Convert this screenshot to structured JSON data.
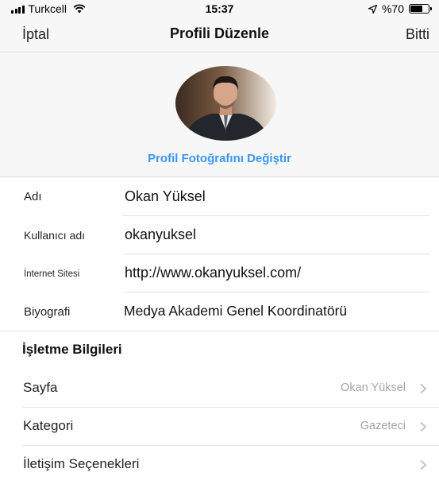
{
  "status_bar": {
    "carrier": "Turkcell",
    "time": "15:37",
    "battery_text": "%70",
    "battery_level": 0.7
  },
  "nav": {
    "cancel_label": "İptal",
    "title": "Profili Düzenle",
    "done_label": "Bitti"
  },
  "profile_photo": {
    "change_label": "Profil Fotoğrafını Değiştir"
  },
  "form": [
    {
      "label": "Adı",
      "value": "Okan Yüksel"
    },
    {
      "label": "Kullanıcı adı",
      "value": "okanyuksel"
    },
    {
      "label": "İnternet Sitesi",
      "value": "http://www.okanyuksel.com/"
    },
    {
      "label": "Biyografi",
      "value": "Medya Akademi Genel Koordinatörü"
    }
  ],
  "business": {
    "header": "İşletme Bilgileri",
    "rows": [
      {
        "label": "Sayfa",
        "value": "Okan Yüksel"
      },
      {
        "label": "Kategori",
        "value": "Gazeteci"
      },
      {
        "label": "İletişim Seçenekleri",
        "value": ""
      }
    ]
  },
  "colors": {
    "accent": "#3897f0",
    "secondary_text": "#a5a5a5",
    "bar_background": "#f7f7f7"
  },
  "icons": [
    "signal-icon",
    "wifi-icon",
    "location-arrow-icon",
    "battery-icon",
    "chevron-right-icon"
  ]
}
